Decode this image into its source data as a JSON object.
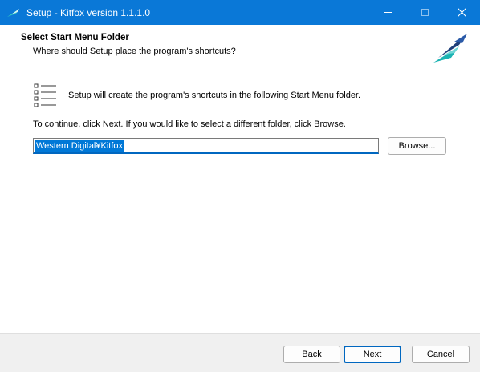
{
  "window": {
    "title": "Setup - Kitfox version 1.1.1.0",
    "accent_color": "#0a78d7",
    "icon": "kitfox-bird-icon"
  },
  "header": {
    "title": "Select Start Menu Folder",
    "subtitle": "Where should Setup place the program's shortcuts?",
    "logo": "kitfox-logo"
  },
  "body": {
    "intro": "Setup will create the program's shortcuts in the following Start Menu folder.",
    "instruction": "To continue, click Next. If you would like to select a different folder, click Browse.",
    "folder_value": "Western Digital¥Kitfox",
    "browse_label": "Browse..."
  },
  "footer": {
    "back_label": "Back",
    "next_label": "Next",
    "cancel_label": "Cancel"
  }
}
